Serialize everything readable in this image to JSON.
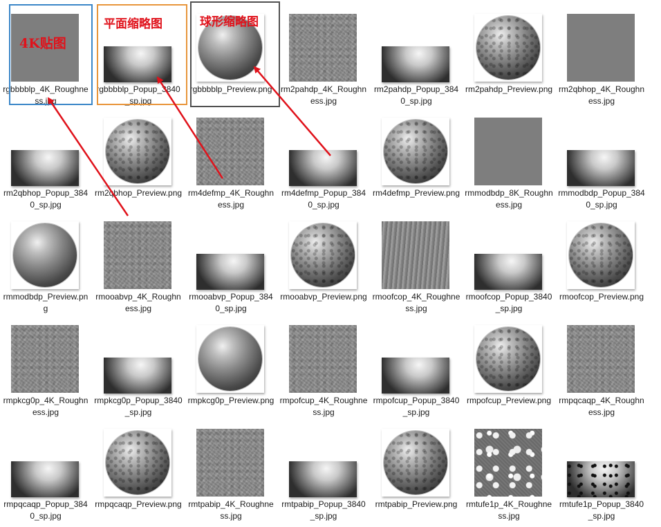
{
  "annotations": {
    "label_4k": "4K贴图",
    "label_flat": "平面缩略图",
    "label_sphere": "球形缩略图",
    "color_4k_box": "#3a86c8",
    "color_flat_box": "#e8953a",
    "color_sphere_box": "#505050",
    "color_text": "#e0121b"
  },
  "files": [
    {
      "name": "rgbbbblp_4K_Roughness.jpg",
      "kind": "roughness",
      "texture": "flat"
    },
    {
      "name": "rgbbbblp_Popup_3840_sp.jpg",
      "kind": "popup",
      "texture": "plain"
    },
    {
      "name": "rgbbbblp_Preview.png",
      "kind": "preview",
      "texture": "smooth"
    },
    {
      "name": "rm2pahdp_4K_Roughness.jpg",
      "kind": "roughness",
      "texture": "noise"
    },
    {
      "name": "rm2pahdp_Popup_3840_sp.jpg",
      "kind": "popup",
      "texture": "plain"
    },
    {
      "name": "rm2pahdp_Preview.png",
      "kind": "preview",
      "texture": "rough"
    },
    {
      "name": "rm2qbhop_4K_Roughness.jpg",
      "kind": "roughness",
      "texture": "flat"
    },
    {
      "name": "rm2qbhop_Popup_3840_sp.jpg",
      "kind": "popup",
      "texture": "plain"
    },
    {
      "name": "rm2qbhop_Preview.png",
      "kind": "preview",
      "texture": "rough"
    },
    {
      "name": "rm4defmp_4K_Roughness.jpg",
      "kind": "roughness",
      "texture": "noise"
    },
    {
      "name": "rm4defmp_Popup_3840_sp.jpg",
      "kind": "popup",
      "texture": "plain"
    },
    {
      "name": "rm4defmp_Preview.png",
      "kind": "preview",
      "texture": "rough"
    },
    {
      "name": "rmmodbdp_8K_Roughness.jpg",
      "kind": "roughness",
      "texture": "flat"
    },
    {
      "name": "rmmodbdp_Popup_3840_sp.jpg",
      "kind": "popup",
      "texture": "plain"
    },
    {
      "name": "rmmodbdp_Preview.png",
      "kind": "preview",
      "texture": "smooth"
    },
    {
      "name": "rmooabvp_4K_Roughness.jpg",
      "kind": "roughness",
      "texture": "noise"
    },
    {
      "name": "rmooabvp_Popup_3840_sp.jpg",
      "kind": "popup",
      "texture": "plain"
    },
    {
      "name": "rmooabvp_Preview.png",
      "kind": "preview",
      "texture": "rough"
    },
    {
      "name": "rmoofcop_4K_Roughness.jpg",
      "kind": "roughness",
      "texture": "streak"
    },
    {
      "name": "rmoofcop_Popup_3840_sp.jpg",
      "kind": "popup",
      "texture": "plain"
    },
    {
      "name": "rmoofcop_Preview.png",
      "kind": "preview",
      "texture": "rough"
    },
    {
      "name": "rmpkcg0p_4K_Roughness.jpg",
      "kind": "roughness",
      "texture": "noise"
    },
    {
      "name": "rmpkcg0p_Popup_3840_sp.jpg",
      "kind": "popup",
      "texture": "plain"
    },
    {
      "name": "rmpkcg0p_Preview.png",
      "kind": "preview",
      "texture": "smooth"
    },
    {
      "name": "rmpofcup_4K_Roughness.jpg",
      "kind": "roughness",
      "texture": "noise"
    },
    {
      "name": "rmpofcup_Popup_3840_sp.jpg",
      "kind": "popup",
      "texture": "plain"
    },
    {
      "name": "rmpofcup_Preview.png",
      "kind": "preview",
      "texture": "rough"
    },
    {
      "name": "rmpqcaqp_4K_Roughness.jpg",
      "kind": "roughness",
      "texture": "noise"
    },
    {
      "name": "rmpqcaqp_Popup_3840_sp.jpg",
      "kind": "popup",
      "texture": "plain"
    },
    {
      "name": "rmpqcaqp_Preview.png",
      "kind": "preview",
      "texture": "rough"
    },
    {
      "name": "rmtpabip_4K_Roughness.jpg",
      "kind": "roughness",
      "texture": "noise"
    },
    {
      "name": "rmtpabip_Popup_3840_sp.jpg",
      "kind": "popup",
      "texture": "plain"
    },
    {
      "name": "rmtpabip_Preview.png",
      "kind": "preview",
      "texture": "rough"
    },
    {
      "name": "rmtufe1p_4K_Roughness.jpg",
      "kind": "roughness",
      "texture": "spots"
    },
    {
      "name": "rmtufe1p_Popup_3840_sp.jpg",
      "kind": "popup",
      "texture": "spotty"
    }
  ]
}
